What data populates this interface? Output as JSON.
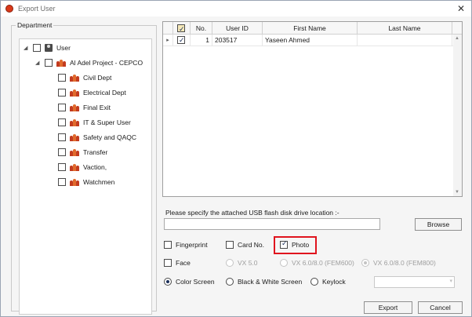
{
  "window": {
    "title": "Export User",
    "close_glyph": "✕"
  },
  "department": {
    "legend": "Department",
    "root": {
      "label": "User",
      "expander": "◢"
    },
    "project": {
      "label": "Al Adel Project - CEPCO",
      "expander": "◢"
    },
    "groups": [
      {
        "label": "Civil Dept"
      },
      {
        "label": "Electrical Dept"
      },
      {
        "label": "Final Exit"
      },
      {
        "label": "IT & Super User"
      },
      {
        "label": "Safety and QAQC"
      },
      {
        "label": "Transfer"
      },
      {
        "label": "Vaction,"
      },
      {
        "label": "Watchmen"
      }
    ]
  },
  "grid": {
    "columns": [
      "",
      "No.",
      "User ID",
      "First Name",
      "Last Name"
    ],
    "row_marker": "▸",
    "rows": [
      {
        "checked": true,
        "no": "1",
        "user_id": "203517",
        "first_name": "Yaseen Ahmed",
        "last_name": ""
      }
    ]
  },
  "usb": {
    "label": "Please specify the attached USB flash disk drive location :-",
    "value": "",
    "browse_label": "Browse"
  },
  "options": {
    "fingerprint": {
      "label": "Fingerprint",
      "checked": false
    },
    "card_no": {
      "label": "Card No.",
      "checked": false
    },
    "photo": {
      "label": "Photo",
      "checked": true
    },
    "face": {
      "label": "Face",
      "checked": false
    },
    "vx50": {
      "label": "VX 5.0"
    },
    "vx60_fem600": {
      "label": "VX 6.0/8.0 (FEM600)"
    },
    "vx60_fem800": {
      "label": "VX 6.0/8.0 (FEM800)"
    },
    "color_screen": {
      "label": "Color Screen"
    },
    "bw_screen": {
      "label": "Black & White Screen"
    },
    "keylock": {
      "label": "Keylock"
    },
    "combo_value": "",
    "combo_arrow": "▾"
  },
  "buttons": {
    "export_label": "Export",
    "cancel_label": "Cancel"
  },
  "colors": {
    "highlight": "#e0141e",
    "accent_check": "#1b2f5a"
  }
}
